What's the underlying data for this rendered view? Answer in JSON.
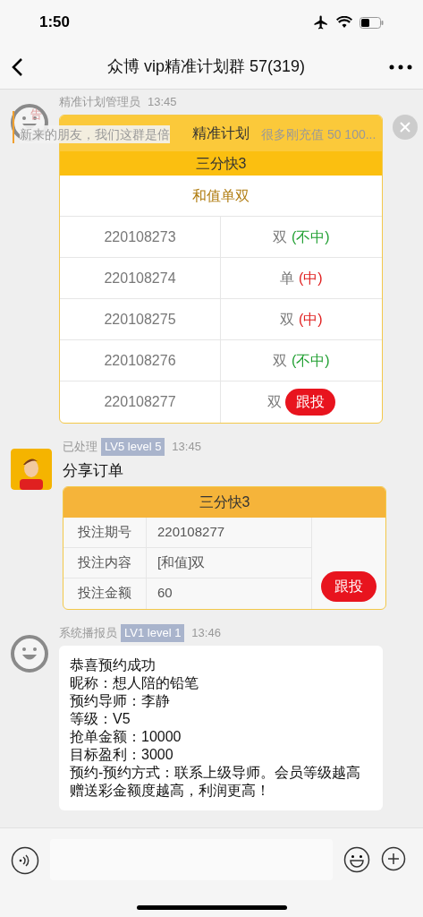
{
  "status_bar": {
    "time": "1:50"
  },
  "nav": {
    "title": "众博 vip精准计划群 57(319)"
  },
  "announcement": {
    "label": "告",
    "text_left": "新来的朋友，我们这群是倍",
    "text_right": "很多刚充值 50 100..."
  },
  "messages": [
    {
      "kind": "plan",
      "sender": "精准计划管理员",
      "time": "13:45",
      "card": {
        "title": "精准计划",
        "game": "三分快3",
        "column_title": "和值单双",
        "rows": [
          {
            "issue": "220108273",
            "value": "双",
            "kind": "result",
            "hit": false,
            "outcome": "(不中)"
          },
          {
            "issue": "220108274",
            "value": "单",
            "kind": "result",
            "hit": true,
            "outcome": "(中)"
          },
          {
            "issue": "220108275",
            "value": "双",
            "kind": "result",
            "hit": true,
            "outcome": "(中)"
          },
          {
            "issue": "220108276",
            "value": "双",
            "kind": "result",
            "hit": false,
            "outcome": "(不中)"
          },
          {
            "issue": "220108277",
            "value": "双",
            "kind": "action",
            "button": "跟投"
          }
        ]
      }
    },
    {
      "kind": "order",
      "sender": "已处理",
      "badge": "LV5 level 5",
      "time": "13:45",
      "text": "分享订单",
      "card": {
        "game": "三分快3",
        "rows": [
          {
            "label": "投注期号",
            "value": "220108277"
          },
          {
            "label": "投注内容",
            "value": "[和值]双"
          },
          {
            "label": "投注金额",
            "value": "60"
          }
        ],
        "button": "跟投"
      }
    },
    {
      "kind": "text",
      "sender": "系统播报员",
      "badge": "LV1 level 1",
      "time": "13:46",
      "lines": [
        "恭喜预约成功",
        "昵称：想人陪的铅笔",
        "预约导师：李静",
        "等级：V5",
        "抢单金额：10000",
        "目标盈利：3000",
        "预约-预约方式：联系上级导师。会员等级越高赠送彩金额度越高，利润更高！"
      ]
    }
  ]
}
